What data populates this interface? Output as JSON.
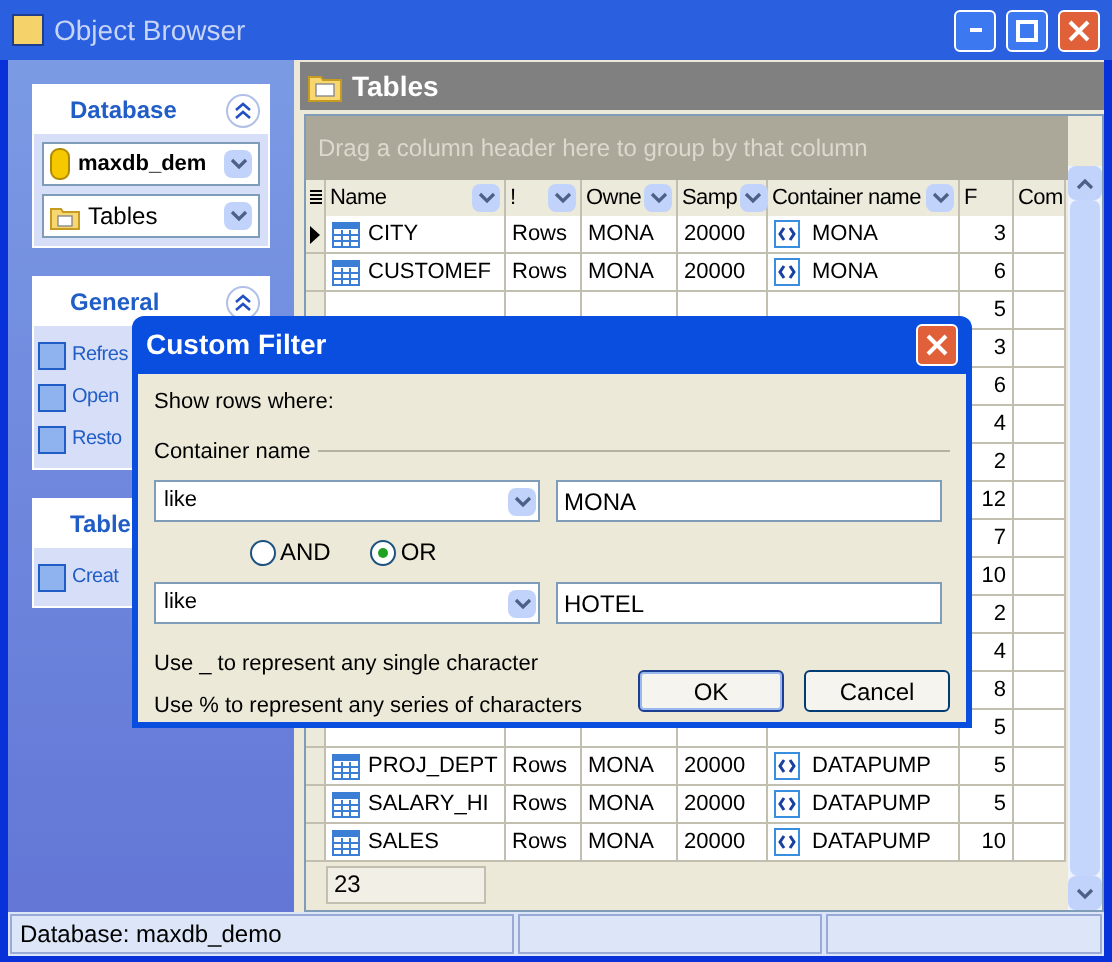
{
  "window": {
    "title": "Object Browser"
  },
  "sidebar": {
    "groups": [
      {
        "title": "Database",
        "expanded": true,
        "database": "maxdb_dem",
        "object_type": "Tables"
      },
      {
        "title": "General",
        "expanded": true,
        "items": [
          "Refres",
          "Open",
          "Resto"
        ]
      },
      {
        "title": "Table",
        "items": [
          "Creat"
        ]
      }
    ]
  },
  "panel": {
    "title": "Tables",
    "group_hint": "Drag a column header here to group by that column",
    "columns": [
      "Name",
      "!",
      "Owne",
      "Samp",
      "Container name",
      "F",
      "Com"
    ],
    "rows": [
      {
        "selected": true,
        "name": "CITY",
        "type": "Rows",
        "owner": "MONA",
        "sample": "20000",
        "container": "MONA",
        "f": "3"
      },
      {
        "selected": false,
        "name": "CUSTOMEF",
        "type": "Rows",
        "owner": "MONA",
        "sample": "20000",
        "container": "MONA",
        "f": "6"
      },
      {
        "selected": false,
        "f": "5"
      },
      {
        "f": "3"
      },
      {
        "f": "6"
      },
      {
        "f": "4"
      },
      {
        "f": "2"
      },
      {
        "f": "12"
      },
      {
        "f": "7"
      },
      {
        "f": "10"
      },
      {
        "f": "2"
      },
      {
        "f": "4"
      },
      {
        "f": "8"
      },
      {
        "selected": false,
        "f": "5"
      },
      {
        "selected": false,
        "name": "PROJ_DEPT",
        "type": "Rows",
        "owner": "MONA",
        "sample": "20000",
        "container": "DATAPUMP",
        "f": "5"
      },
      {
        "selected": false,
        "name": "SALARY_HI",
        "type": "Rows",
        "owner": "MONA",
        "sample": "20000",
        "container": "DATAPUMP",
        "f": "5"
      },
      {
        "selected": false,
        "name": "SALES",
        "type": "Rows",
        "owner": "MONA",
        "sample": "20000",
        "container": "DATAPUMP",
        "f": "10"
      }
    ],
    "count": "23"
  },
  "dialog": {
    "title": "Custom Filter",
    "intro": "Show rows where:",
    "field": "Container name",
    "conditions": [
      {
        "operator": "like",
        "value": "MONA"
      },
      {
        "operator": "like",
        "value": "HOTEL"
      }
    ],
    "logic": [
      {
        "label": "AND",
        "selected": false
      },
      {
        "label": "OR",
        "selected": true
      }
    ],
    "hints": [
      "Use _ to represent any single character",
      "Use % to represent any series of characters"
    ],
    "buttons": [
      "OK",
      "Cancel"
    ]
  },
  "status_bar": [
    "Database: maxdb_demo"
  ]
}
